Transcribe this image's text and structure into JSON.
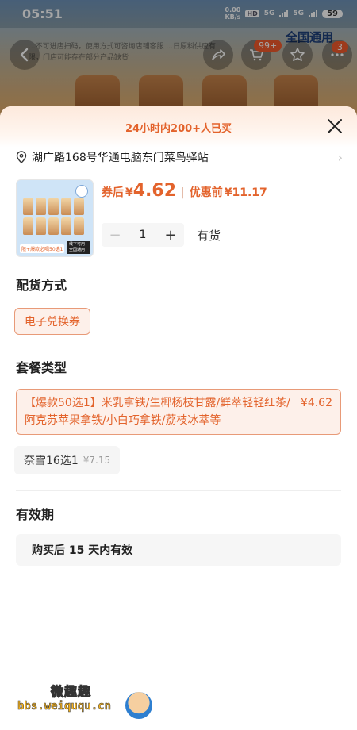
{
  "status_bar": {
    "time": "05:51",
    "speed_value": "0.00",
    "speed_unit": "KB/s",
    "hd": "HD",
    "net1": "5G",
    "net2": "5G",
    "battery": "59"
  },
  "background": {
    "notice_text": "...不可进店扫码，使用方式可咨询店铺客服 ...日原料供应有限，门店可能存在部分产品缺货",
    "region_label": "全国通用",
    "cart_badge": "99+",
    "more_badge": "3"
  },
  "sheet": {
    "banner": "24小时内200+人已买",
    "address": "湖广路168号华通电脑东门菜鸟驿站",
    "price": {
      "after_coupon_label": "券后",
      "currency": "¥",
      "after_coupon_value": "4.62",
      "original_label": "优惠前",
      "original_value": "¥11.17"
    },
    "thumbnail": {
      "label_left": "限+爆款必喝50选1",
      "label_right": "线下可用 全国通用"
    },
    "quantity": {
      "minus": "−",
      "value": "1",
      "plus": "+"
    },
    "stock": "有货",
    "delivery": {
      "title": "配货方式",
      "options": [
        "电子兑换券"
      ]
    },
    "package": {
      "title": "套餐类型",
      "options": [
        {
          "name": "【爆款50选1】米乳拿铁/生椰杨枝甘露/鲜萃轻轻红茶/阿克苏苹果拿铁/小白巧拿铁/荔枝冰萃等",
          "price": "¥4.62",
          "selected": true
        },
        {
          "name": "奈雪16选1",
          "price": "¥7.15",
          "selected": false
        }
      ]
    },
    "validity": {
      "title": "有效期",
      "value": "购买后 15 天内有效"
    }
  },
  "watermark": {
    "title": "微趣趣",
    "url": "bbs.weiququ.cn"
  },
  "colors": {
    "accent": "#e3632c",
    "selected_bg": "#fdf0ea",
    "selected_border": "#e89a78"
  }
}
